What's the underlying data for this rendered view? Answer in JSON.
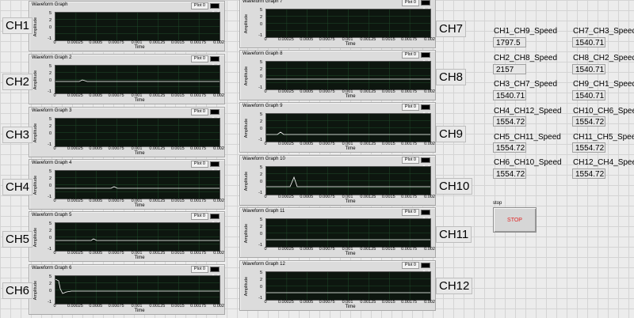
{
  "graph_common": {
    "legend_plot": "Plot 0",
    "y_axis_label": "Amplitude",
    "x_axis_label": "Time",
    "y_ticks": [
      "5",
      "2",
      "0",
      "-1"
    ],
    "x_ticks": [
      "0",
      "0.00025",
      "0.0005",
      "0.00075",
      "0.001",
      "0.00125",
      "0.0015",
      "0.00175",
      "0.002"
    ],
    "plot_bg_color": "#0d160f",
    "grid_color": "#1f4a2a",
    "trace_color": "#ffffff"
  },
  "graphs": [
    {
      "title": "Waveform Graph",
      "channel": "CH1"
    },
    {
      "title": "Waveform Graph 2",
      "channel": "CH2"
    },
    {
      "title": "Waveform Graph 3",
      "channel": "CH3"
    },
    {
      "title": "Waveform Graph 4",
      "channel": "CH4"
    },
    {
      "title": "Waveform Graph 5",
      "channel": "CH5"
    },
    {
      "title": "Waveform Graph 6",
      "channel": "CH6"
    },
    {
      "title": "Waveform Graph 7",
      "channel": "CH7"
    },
    {
      "title": "Waveform Graph 8",
      "channel": "CH8"
    },
    {
      "title": "Waveform Graph 9",
      "channel": "CH9"
    },
    {
      "title": "Waveform Graph 10",
      "channel": "CH10"
    },
    {
      "title": "Waveform Graph 11",
      "channel": "CH11"
    },
    {
      "title": "Waveform Graph 12",
      "channel": "CH12"
    }
  ],
  "speeds": [
    {
      "label": "CH1_CH9_Speed",
      "value": "1797.5"
    },
    {
      "label": "CH2_CH8_Speed",
      "value": "2157"
    },
    {
      "label": "CH3_CH7_Speed",
      "value": "1540.71"
    },
    {
      "label": "CH4_CH12_Speed",
      "value": "1554.72"
    },
    {
      "label": "CH5_CH11_Speed",
      "value": "1554.72"
    },
    {
      "label": "CH6_CH10_Speed",
      "value": "1554.72"
    },
    {
      "label": "CH7_CH3_Speed",
      "value": "1540.71"
    },
    {
      "label": "CH8_CH2_Speed",
      "value": "1540.71"
    },
    {
      "label": "CH9_CH1_Speed",
      "value": "1540.71"
    },
    {
      "label": "CH10_CH6_Speed",
      "value": "1554.72"
    },
    {
      "label": "CH11_CH5_Speed",
      "value": "1554.72"
    },
    {
      "label": "CH12_CH4_Speed",
      "value": "1554.72"
    }
  ],
  "stop": {
    "label": "stop",
    "button": "STOP",
    "color": "#e02424"
  }
}
